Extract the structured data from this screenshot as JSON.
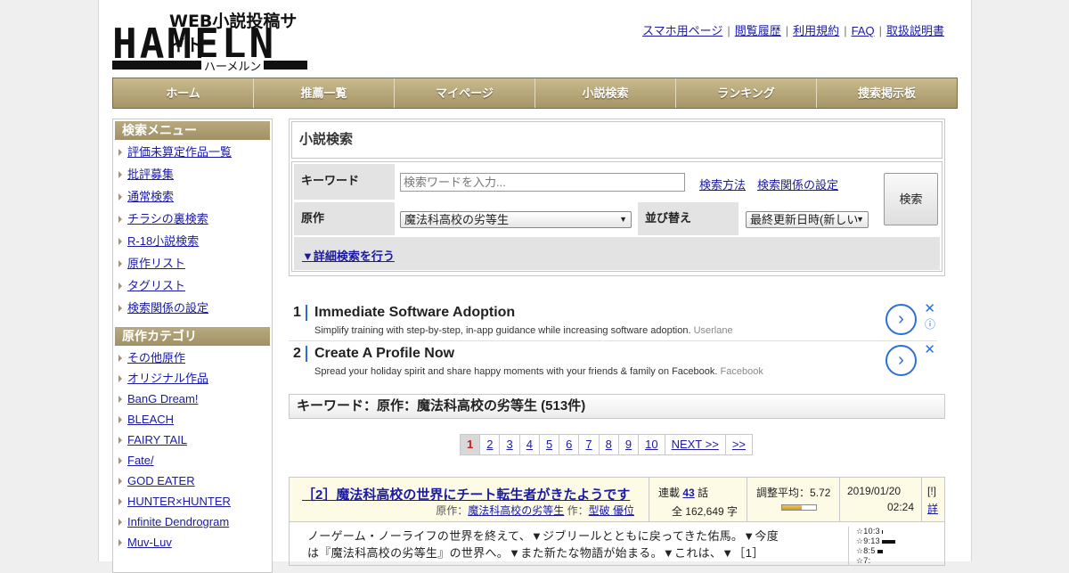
{
  "logo": {
    "sub": "WEB小説投稿サイト",
    "main": "HAMELN",
    "kana": "ハーメルン"
  },
  "toplinks": [
    "スマホ用ページ",
    "閲覧履歴",
    "利用規約",
    "FAQ",
    "取扱説明書"
  ],
  "nav": [
    "ホーム",
    "推薦一覧",
    "マイページ",
    "小説検索",
    "ランキング",
    "捜索掲示板"
  ],
  "sidebar": {
    "menu_title": "検索メニュー",
    "menu_items": [
      "評価未算定作品一覧",
      "批評募集",
      "通常検索",
      "チラシの裏検索",
      "R-18小説検索",
      "原作リスト",
      "タグリスト",
      "検索関係の設定"
    ],
    "category_title": "原作カテゴリ",
    "category_items": [
      "その他原作",
      "オリジナル作品",
      "BanG Dream!",
      "BLEACH",
      "FAIRY TAIL",
      "Fate/",
      "GOD EATER",
      "HUNTER×HUNTER",
      "Infinite Dendrogram",
      "Muv-Luv"
    ]
  },
  "search": {
    "title": "小説検索",
    "keyword_label": "キーワード",
    "keyword_placeholder": "検索ワードを入力...",
    "help_link": "検索方法",
    "settings_link": "検索関係の設定",
    "origin_label": "原作",
    "origin_value": "魔法科高校の劣等生",
    "sort_label": "並び替え",
    "sort_value": "最終更新日時(新しい",
    "button": "検索",
    "detail_link": "▼詳細検索を行う"
  },
  "ads": [
    {
      "num": "1",
      "title": "Immediate Software Adoption",
      "desc": "Simplify training with step-by-step, in-app guidance while increasing software adoption.",
      "src": "Userlane"
    },
    {
      "num": "2",
      "title": "Create A Profile Now",
      "desc": "Spread your holiday spirit and share happy moments with your friends & family on Facebook.",
      "src": "Facebook"
    }
  ],
  "result_heading": "キーワード：原作：魔法科高校の劣等生 (513件)",
  "pager": {
    "pages": [
      "1",
      "2",
      "3",
      "4",
      "5",
      "6",
      "7",
      "8",
      "9",
      "10",
      "NEXT >>",
      ">>"
    ],
    "current": "1"
  },
  "novel": {
    "title": "［2］魔法科高校の世界にチート転生者がきたようです",
    "origin_label": "原作：",
    "origin": "魔法科高校の劣等生",
    "author_label": " 作：",
    "author": "型破 優位",
    "status": "連載",
    "episodes": "43",
    "episodes_unit": "話",
    "chars": "全 162,649 字",
    "score_label": "調整平均：",
    "score": "5.72",
    "score_fraction": 0.572,
    "date": "2019/01/20",
    "time": "02:24",
    "flag": "[!]",
    "detail": "詳",
    "summary_1": "ノーゲーム・ノーライフの世界を終えて、▼ジブリールとともに戻ってきた佑馬。▼今度",
    "summary_2": "は『魔法科高校の劣等生』の世界へ。▼また新たな物語が始まる。▼これは、▼［1］",
    "stars": [
      {
        "label": "☆10:3",
        "fraction": 0.05
      },
      {
        "label": "☆9:13",
        "fraction": 0.6
      },
      {
        "label": "☆8:5",
        "fraction": 0.25
      },
      {
        "label": "☆7:",
        "fraction": 0.0
      }
    ]
  },
  "colors": {
    "nav_top": "#c9bb8e",
    "nav_bottom": "#a59466",
    "link": "#1a1aa6",
    "current_page": "#d01818",
    "ad_accent": "#2a6fdb"
  }
}
